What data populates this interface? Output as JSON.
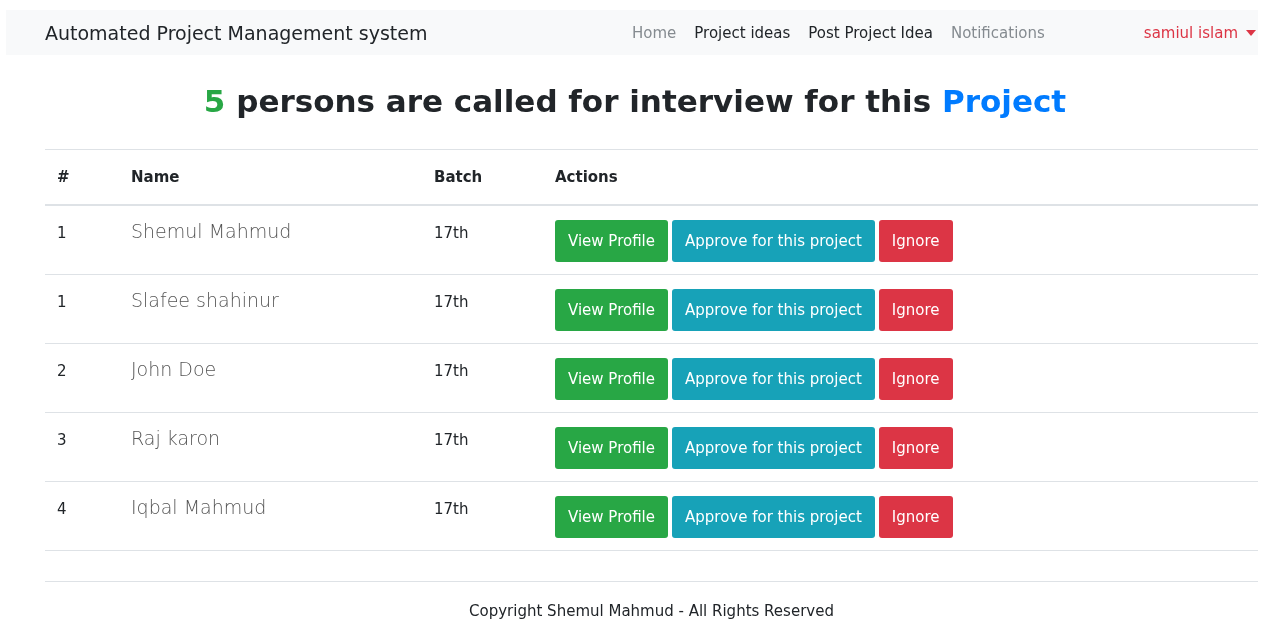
{
  "navbar": {
    "brand": "Automated Project Management system",
    "links": [
      {
        "label": "Home",
        "active": false
      },
      {
        "label": "Project ideas",
        "active": true
      },
      {
        "label": "Post Project Idea",
        "active": true
      },
      {
        "label": "Notifications",
        "active": false
      }
    ],
    "user_menu": {
      "label": "samiul islam"
    }
  },
  "heading": {
    "count": "5",
    "text": "persons are called for interview for this",
    "link": "Project"
  },
  "table": {
    "columns": [
      "#",
      "Name",
      "Batch",
      "Actions"
    ],
    "rows": [
      {
        "index": "1",
        "name": "Shemul Mahmud",
        "batch": "17th",
        "actions": [
          "View Profile",
          "Approve for this project",
          "Ignore"
        ]
      },
      {
        "index": "1",
        "name": "Slafee shahinur",
        "batch": "17th",
        "actions": [
          "View Profile",
          "Approve for this project",
          "Ignore"
        ]
      },
      {
        "index": "2",
        "name": "John Doe",
        "batch": "17th",
        "actions": [
          "View Profile",
          "Approve for this project",
          "Ignore"
        ]
      },
      {
        "index": "3",
        "name": "Raj karon",
        "batch": "17th",
        "actions": [
          "View Profile",
          "Approve for this project",
          "Ignore"
        ]
      },
      {
        "index": "4",
        "name": "Iqbal Mahmud",
        "batch": "17th",
        "actions": [
          "View Profile",
          "Approve for this project",
          "Ignore"
        ]
      }
    ]
  },
  "footer": {
    "text": "Copyright Shemul Mahmud - All Rights Reserved"
  }
}
